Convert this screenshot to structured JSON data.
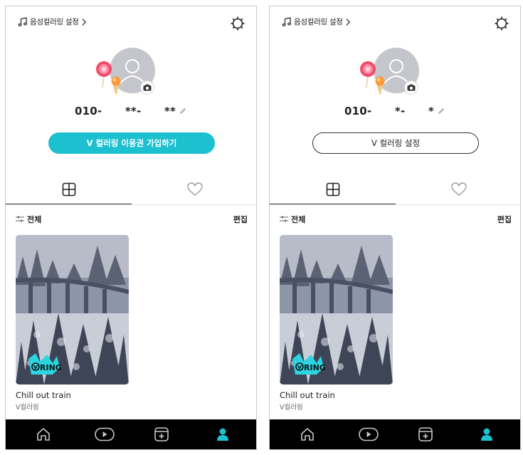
{
  "colors": {
    "accent": "#1cc0cf",
    "nav_bg": "#000000",
    "nav_icon": "#c8c8c8",
    "nav_active": "#1cc0cf"
  },
  "panels": [
    {
      "voice_link": {
        "label": "음성컬러링 설정",
        "icon": "music-note-icon"
      },
      "phone": {
        "prefix": "010-",
        "masked": "      **-      **"
      },
      "cta": {
        "label": "V 컬러링 이용권 가입하기",
        "style": "filled"
      },
      "tabs": {
        "grid_icon": "grid-icon",
        "like_icon": "heart-icon",
        "active": "grid"
      },
      "filter": {
        "label": "전체"
      },
      "edit_label": "편집",
      "card": {
        "title": "Chill out train",
        "subtitle": "V컬러링",
        "badge": "RING"
      },
      "nav": [
        "home-icon",
        "play-icon",
        "add-icon",
        "profile-icon"
      ]
    },
    {
      "voice_link": {
        "label": "음성컬러링 설정",
        "icon": "music-note-icon"
      },
      "phone": {
        "prefix": "010-",
        "masked": "      *-      *"
      },
      "cta": {
        "label": "V 컬러링 설정",
        "style": "outline"
      },
      "tabs": {
        "grid_icon": "grid-icon",
        "like_icon": "heart-icon",
        "active": "grid"
      },
      "filter": {
        "label": "전체"
      },
      "edit_label": "편집",
      "card": {
        "title": "Chill out train",
        "subtitle": "V컬러링",
        "badge": "RING"
      },
      "nav": [
        "home-icon",
        "play-icon",
        "add-icon",
        "profile-icon"
      ]
    }
  ]
}
